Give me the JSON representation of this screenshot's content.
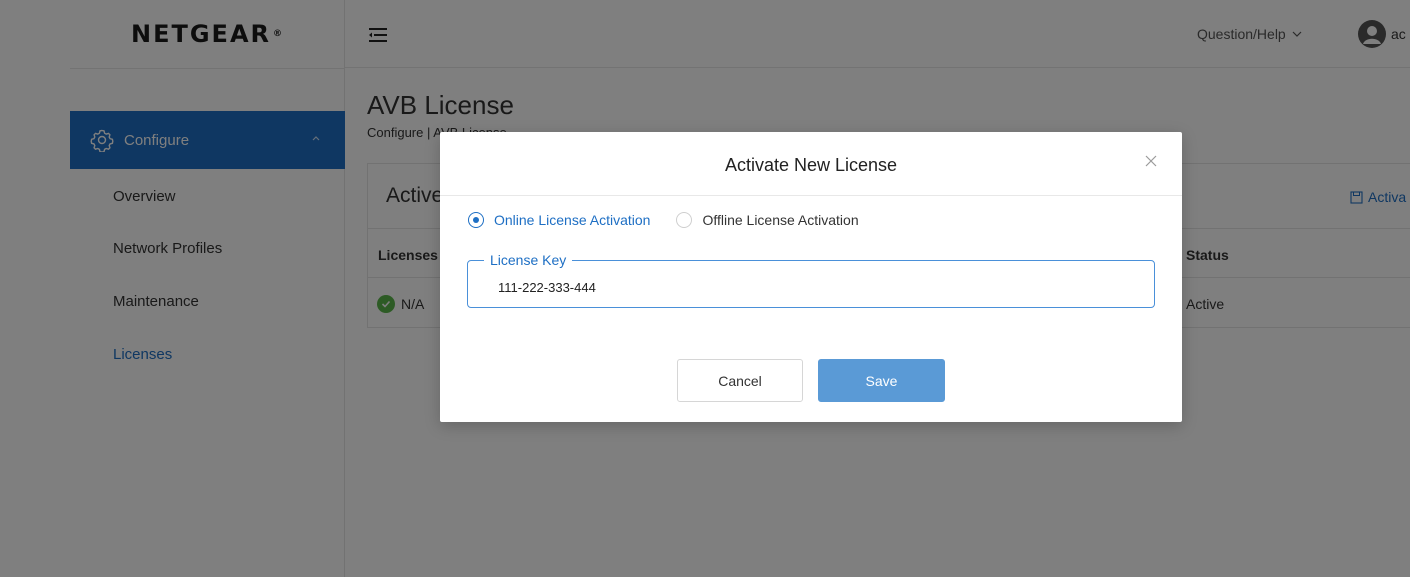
{
  "brand": {
    "logo_text": "NETGEAR",
    "logo_mark": "®"
  },
  "topbar": {
    "help_label": "Question/Help",
    "user_label": "ac"
  },
  "sidebar": {
    "configure_label": "Configure",
    "items": [
      {
        "label": "Overview"
      },
      {
        "label": "Network Profiles"
      },
      {
        "label": "Maintenance"
      },
      {
        "label": "Licenses"
      }
    ]
  },
  "page": {
    "title": "AVB License",
    "breadcrumb": "Configure | AVB License"
  },
  "card": {
    "title": "Active",
    "action_label": "Activa",
    "columns": [
      "Licenses",
      "Status"
    ],
    "rows": [
      {
        "license": "N/A",
        "status": "Active"
      }
    ]
  },
  "modal": {
    "title": "Activate New License",
    "radio_online": "Online License Activation",
    "radio_offline": "Offline License Activation",
    "field_label": "License Key",
    "field_value": "111-222-333-444",
    "cancel_label": "Cancel",
    "save_label": "Save"
  },
  "colors": {
    "accent": "#1e6fc4",
    "save": "#5a9ad6",
    "success": "#5ab74a"
  }
}
